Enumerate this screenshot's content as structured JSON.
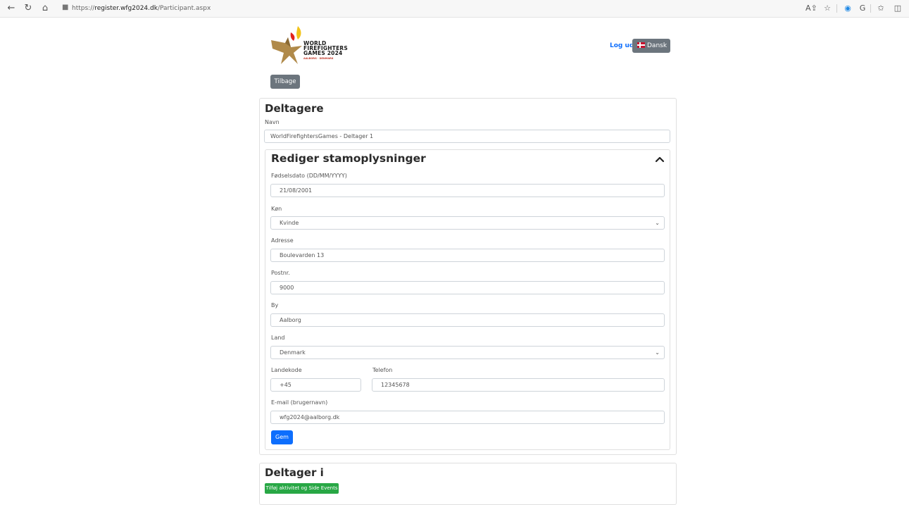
{
  "browser": {
    "url_prefix": "https://",
    "url_domain": "register.wfg2024.dk",
    "url_path": "/Participant.aspx",
    "toolbar_icons": [
      "read-aloud-icon",
      "favorites-add-icon",
      "extension-icon",
      "extension-g-icon",
      "favorites-icon",
      "collections-icon"
    ]
  },
  "header": {
    "logo_line1": "WORLD",
    "logo_line2": "FIREFIGHTERS",
    "logo_line3": "GAMES 2024",
    "logo_sub": "AALBORG · DENMARK",
    "logout_label": "Log ud",
    "language_label": "Dansk",
    "back_label": "Tilbage"
  },
  "participants": {
    "title": "Deltagere",
    "name_label": "Navn",
    "name_value": "WorldFirefightersGames - Deltager 1"
  },
  "master_data": {
    "title": "Rediger stamoplysninger",
    "birthdate_label": "Fødselsdato (DD/MM/YYYY)",
    "birthdate_value": "21/08/2001",
    "gender_label": "Køn",
    "gender_value": "Kvinde",
    "address_label": "Adresse",
    "address_value": "Boulevarden 13",
    "postal_label": "Postnr.",
    "postal_value": "9000",
    "city_label": "By",
    "city_value": "Aalborg",
    "country_label": "Land",
    "country_value": "Denmark",
    "country_code_label": "Landekode",
    "country_code_value": "+45",
    "phone_label": "Telefon",
    "phone_value": "12345678",
    "email_label": "E-mail (brugernavn)",
    "email_value": "wfg2024@aalborg.dk",
    "save_label": "Gem"
  },
  "participates_in": {
    "title": "Deltager i",
    "add_label": "Tilføj aktivitet og Side Events"
  },
  "colors": {
    "primary": "#0d6efd",
    "secondary": "#6c757d",
    "success": "#28a745"
  }
}
